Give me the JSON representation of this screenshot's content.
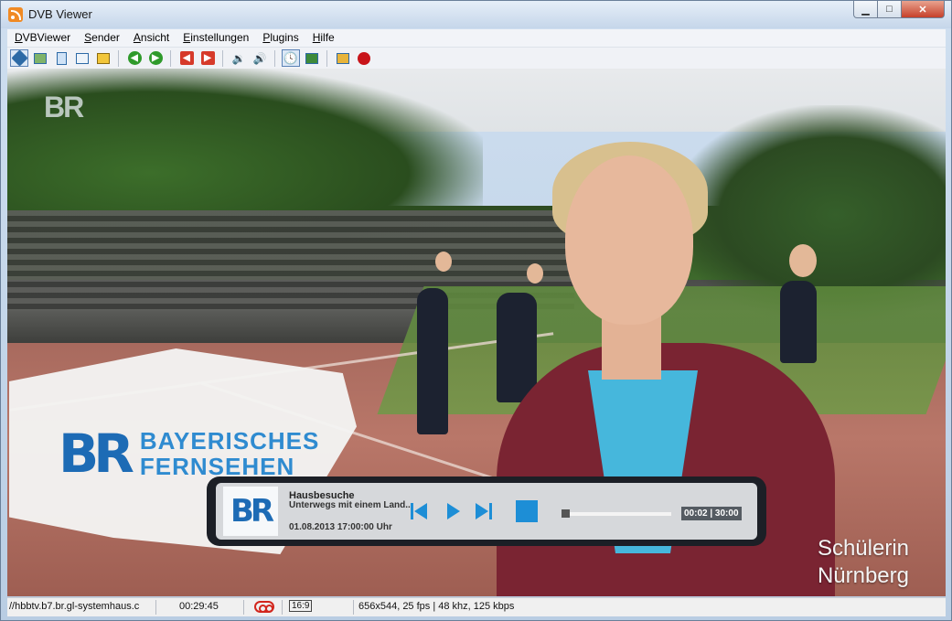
{
  "window": {
    "title": "DVB Viewer"
  },
  "menu": [
    "DVBViewer",
    "Sender",
    "Ansicht",
    "Einstellungen",
    "Plugins",
    "Hilfe"
  ],
  "video": {
    "channel_bug": "BR",
    "logo_mark": "BR",
    "logo_line1": "BAYERISCHES",
    "logo_line2": "FERNSEHEN",
    "caption_line1": "Schülerin",
    "caption_line2": "Nürnberg"
  },
  "osd": {
    "logo": "BR",
    "title": "Hausbesuche",
    "subtitle": "Unterwegs mit einem Land...",
    "datetime": "01.08.2013 17:00:00 Uhr",
    "time": "00:02 | 30:00",
    "progress_fraction": 0.01
  },
  "status": {
    "url": "//hbbtv.b7.br.gl-systemhaus.c",
    "time": "00:29:45",
    "ratio": "16:9",
    "info": "656x544, 25 fps | 48 khz, 125 kbps"
  },
  "colors": {
    "br_blue": "#1d6bb5",
    "close_red": "#c6402a"
  }
}
